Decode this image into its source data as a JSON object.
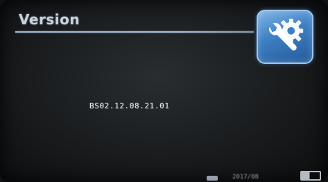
{
  "header": {
    "title": "Version"
  },
  "settings_button": {
    "icon": "wrench-gear-icon"
  },
  "main": {
    "version_string": "BS02.12.08.21.01"
  },
  "status_bar": {
    "left_icon": "status-icon",
    "time_text": "2017/08",
    "right_icon": "card-icon"
  },
  "colors": {
    "background": "#1e2123",
    "title_text": "#c9d3dd",
    "accent_blue": "#3d7fc2",
    "text": "#dfe6ec"
  }
}
